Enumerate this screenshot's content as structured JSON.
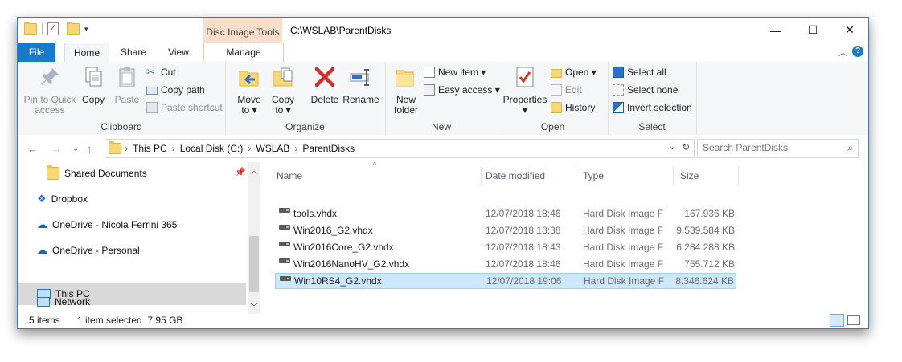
{
  "quick_access_toolbar": {
    "icons": [
      "folder-icon",
      "properties-check-icon",
      "new-folder-icon",
      "customize-dropdown-icon"
    ]
  },
  "title_bar": {
    "context_tab_title": "Disc Image Tools",
    "path_title": "C:\\WSLAB\\ParentDisks",
    "minimize": "—",
    "maximize": "☐",
    "close": "✕"
  },
  "ribbon_tabs": {
    "file": "File",
    "home": "Home",
    "share": "Share",
    "view": "View",
    "manage": "Manage",
    "help": "?"
  },
  "ribbon": {
    "clipboard": {
      "label": "Clipboard",
      "pin_line1": "Pin to Quick",
      "pin_line2": "access",
      "copy": "Copy",
      "paste": "Paste",
      "cut": "Cut",
      "copy_path": "Copy path",
      "paste_shortcut": "Paste shortcut"
    },
    "organize": {
      "label": "Organize",
      "move_line1": "Move",
      "move_line2": "to ▾",
      "copy_line1": "Copy",
      "copy_line2": "to ▾",
      "delete": "Delete",
      "rename": "Rename"
    },
    "new": {
      "label": "New",
      "new_folder_line1": "New",
      "new_folder_line2": "folder",
      "new_item": "New item ▾",
      "easy_access": "Easy access ▾"
    },
    "open": {
      "label": "Open",
      "properties": "Properties",
      "properties_drop": "▾",
      "open": "Open ▾",
      "edit": "Edit",
      "history": "History"
    },
    "select": {
      "label": "Select",
      "select_all": "Select all",
      "select_none": "Select none",
      "invert_selection": "Invert selection"
    }
  },
  "address_bar": {
    "crumbs": [
      "This PC",
      "Local Disk (C:)",
      "WSLAB",
      "ParentDisks"
    ],
    "search_placeholder": "Search ParentDisks"
  },
  "nav_pane": {
    "items": [
      {
        "label": "Shared Documents",
        "icon": "folder-icon"
      },
      {
        "label": "Dropbox",
        "icon": "dropbox-icon"
      },
      {
        "label": "OneDrive - Nicola Ferrini 365",
        "icon": "onedrive-icon"
      },
      {
        "label": "OneDrive - Personal",
        "icon": "onedrive-icon"
      },
      {
        "label": "This PC",
        "icon": "computer-icon"
      },
      {
        "label": "Network",
        "icon": "network-icon"
      }
    ]
  },
  "file_list": {
    "columns": {
      "name": "Name",
      "date": "Date modified",
      "type": "Type",
      "size": "Size"
    },
    "rows": [
      {
        "name": "tools.vhdx",
        "date": "12/07/2018 18:46",
        "type": "Hard Disk Image F",
        "size": "167.936 KB"
      },
      {
        "name": "Win2016_G2.vhdx",
        "date": "12/07/2018 18:38",
        "type": "Hard Disk Image F",
        "size": "9.539.584 KB"
      },
      {
        "name": "Win2016Core_G2.vhdx",
        "date": "12/07/2018 18:43",
        "type": "Hard Disk Image F",
        "size": "6.284.288 KB"
      },
      {
        "name": "Win2016NanoHV_G2.vhdx",
        "date": "12/07/2018 18:46",
        "type": "Hard Disk Image F",
        "size": "755.712 KB"
      },
      {
        "name": "Win10RS4_G2.vhdx",
        "date": "12/07/2018 19:06",
        "type": "Hard Disk Image F",
        "size": "8.346.624 KB"
      }
    ]
  },
  "status_bar": {
    "item_count": "5 items",
    "selection": "1 item selected  7,95 GB"
  },
  "colors": {
    "accent": "#1979ca",
    "context_tab": "#f9dec9",
    "selection": "#cce8ff",
    "selection_border": "#99d1ff"
  }
}
